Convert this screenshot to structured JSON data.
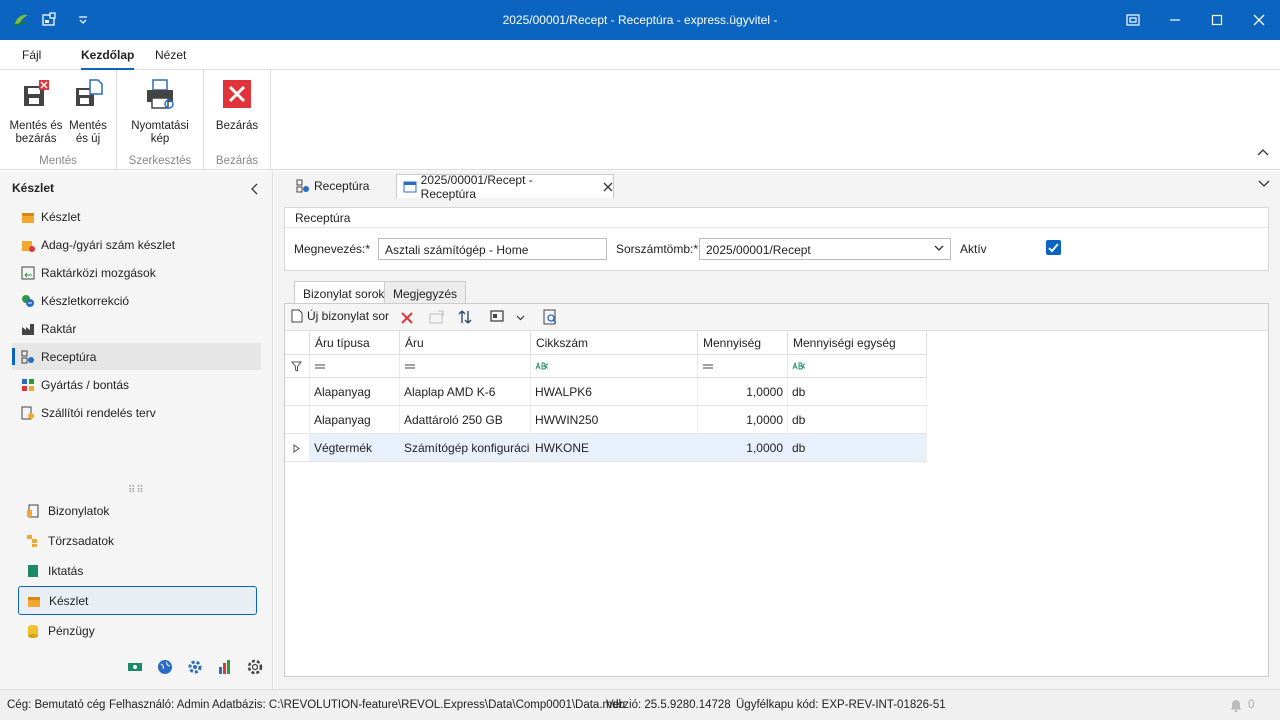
{
  "window": {
    "title": "2025/00001/Recept - Receptúra - express.ügyvitel -"
  },
  "menu": {
    "tabs": [
      "Fájl",
      "Kezdőlap",
      "Nézet"
    ]
  },
  "ribbon": {
    "save_close": "Mentés és bezárás",
    "save_new": "Mentés és új",
    "print_preview": "Nyomtatási kép",
    "close": "Bezárás",
    "group_save": "Mentés",
    "group_edit": "Szerkesztés",
    "group_close": "Bezárás"
  },
  "sidebar": {
    "title": "Készlet",
    "items": [
      "Készlet",
      "Adag-/gyári szám készlet",
      "Raktárközi mozgások",
      "Készletkorrekció",
      "Raktár",
      "Receptúra",
      "Gyártás / bontás",
      "Szállítói rendelés terv"
    ],
    "modules": [
      "Bizonylatok",
      "Törzsadatok",
      "Iktatás",
      "Készlet",
      "Pénzügy"
    ]
  },
  "doc_tabs": [
    "Receptúra",
    "2025/00001/Recept - Receptúra"
  ],
  "form": {
    "panel_title": "Receptúra",
    "name_label": "Megnevezés:*",
    "name_value": "Asztali számítógép - Home",
    "serial_label": "Sorszámtömb:*",
    "serial_value": "2025/00001/Recept",
    "active_label": "Aktív"
  },
  "subtabs": [
    "Bizonylat sorok",
    "Megjegyzés"
  ],
  "toolbar": {
    "new_row": "Új bizonylat sor"
  },
  "grid": {
    "columns": [
      "Áru típusa",
      "Áru",
      "Cikkszám",
      "Mennyiség",
      "Mennyiségi egység"
    ],
    "rows": [
      [
        "Alapanyag",
        "Alaplap AMD K-6",
        "HWALPK6",
        "1,0000",
        "db"
      ],
      [
        "Alapanyag",
        "Adattároló 250 GB",
        "HWWIN250",
        "1,0000",
        "db"
      ],
      [
        "Végtermék",
        "Számítógép konfiguráció",
        "HWKONE",
        "1,0000",
        "db"
      ]
    ]
  },
  "status": {
    "company": "Cég: Bemutató cég",
    "user": "Felhasználó: Admin",
    "database": "Adatbázis: C:\\REVOLUTION-feature\\REVOL.Express\\Data\\Comp0001\\Data.mdb",
    "version": "Verzió: 25.5.9280.14728",
    "client": "Ügyfélkapu kód: EXP-REV-INT-01826-51",
    "notifications": "0"
  },
  "colors": {
    "accent": "#0b64c0",
    "close_red": "#e0333a"
  }
}
